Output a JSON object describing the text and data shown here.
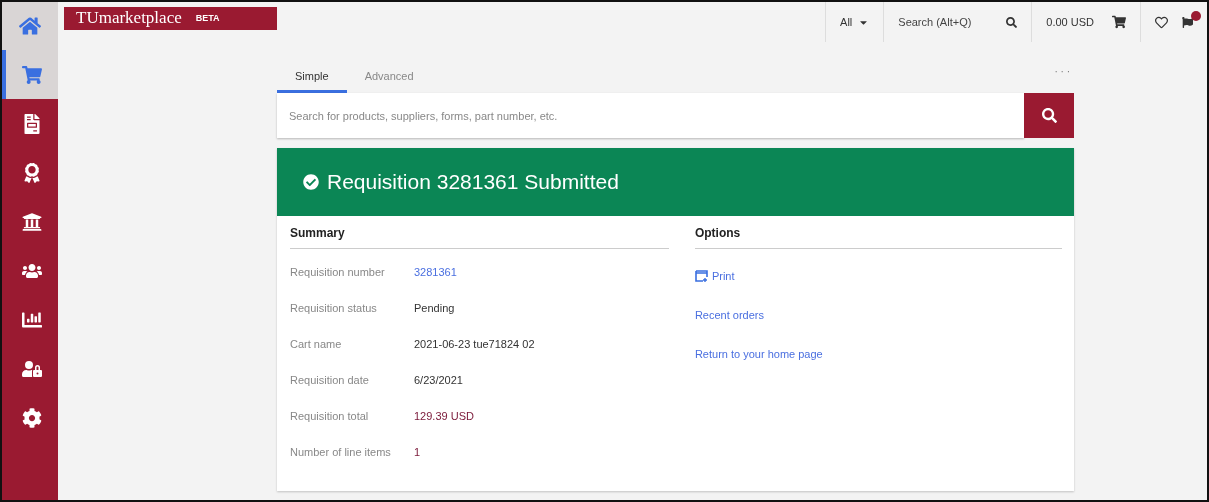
{
  "sidebar": {
    "items": [
      {
        "selected": true
      },
      {
        "selected": false
      },
      {
        "selected": false
      },
      {
        "selected": false
      },
      {
        "selected": false
      },
      {
        "selected": false
      },
      {
        "selected": false
      },
      {
        "selected": false
      }
    ]
  },
  "header": {
    "logo": "TUmarketplace",
    "badge": "BETA",
    "scope": "All",
    "search_placeholder": "Search (Alt+Q)",
    "cart_total": "0.00 USD"
  },
  "tabs": [
    {
      "label": "Simple",
      "selected": true
    },
    {
      "label": "Advanced",
      "selected": false
    }
  ],
  "more": "· · ·",
  "search": {
    "placeholder": "Search for products, suppliers, forms, part number, etc."
  },
  "banner": {
    "title": "Requisition 3281361 Submitted"
  },
  "summary": {
    "title": "Summary",
    "rows": [
      {
        "label": "Requisition number",
        "value": "3281361",
        "kind": "link"
      },
      {
        "label": "Requisition status",
        "value": "Pending",
        "kind": "text"
      },
      {
        "label": "Cart name",
        "value": "2021-06-23 tue71824 02",
        "kind": "text"
      },
      {
        "label": "Requisition date",
        "value": "6/23/2021",
        "kind": "text"
      },
      {
        "label": "Requisition total",
        "value": "129.39 USD",
        "kind": "accent"
      },
      {
        "label": "Number of line items",
        "value": "1",
        "kind": "accent"
      }
    ]
  },
  "options": {
    "title": "Options",
    "links": [
      {
        "label": "Print",
        "kind": "print"
      },
      {
        "label": "Recent orders",
        "kind": "plain"
      },
      {
        "label": "Return to your home page",
        "kind": "plain"
      }
    ]
  }
}
